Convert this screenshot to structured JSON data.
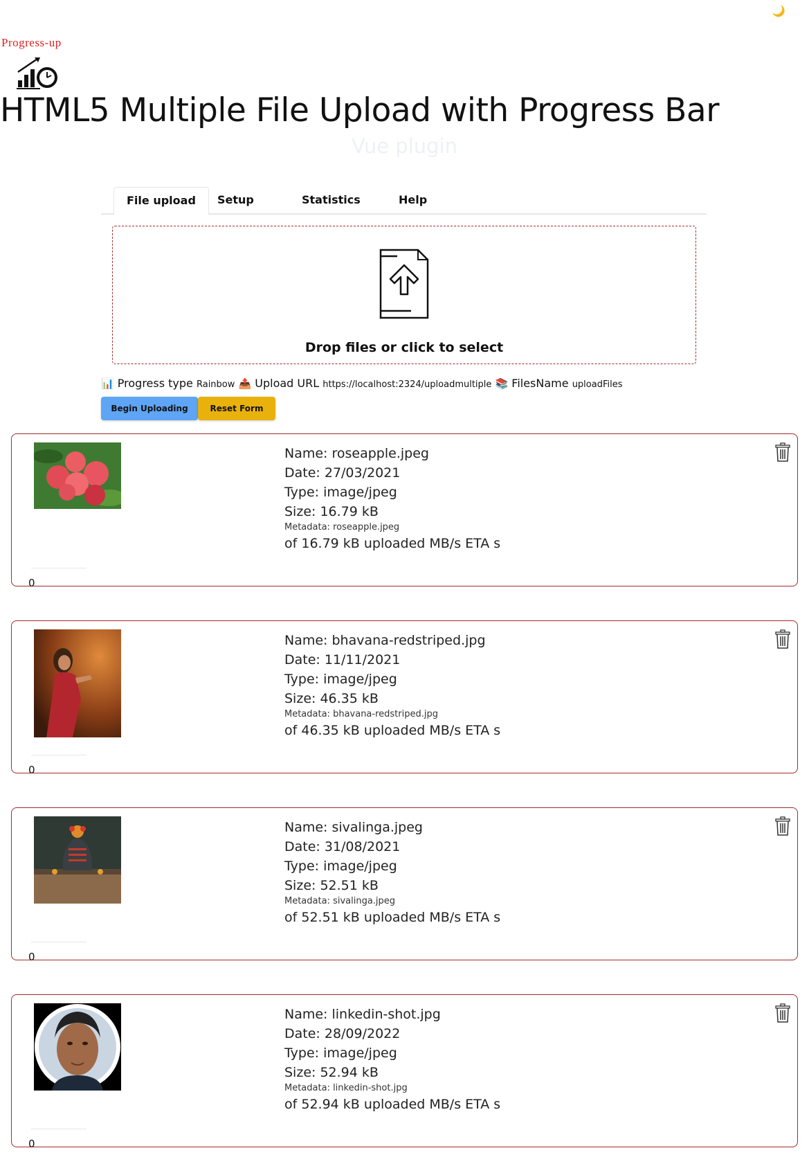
{
  "header": {
    "brand": "Progress-up",
    "title": "HTML5 Multiple File Upload with Progress Bar",
    "subtitle": "Vue plugin",
    "theme_toggle_icon": "moon-icon"
  },
  "tabs": [
    {
      "label": "File upload",
      "active": true
    },
    {
      "label": "Setup",
      "active": false
    },
    {
      "label": "Statistics",
      "active": false
    },
    {
      "label": "Help",
      "active": false
    }
  ],
  "dropzone": {
    "icon": "file-upload-icon",
    "label": "Drop files or click to select"
  },
  "config": {
    "progress_type_icon": "📊",
    "progress_type_label": "Progress type",
    "progress_type_value": "Rainbow",
    "upload_url_icon": "📤",
    "upload_url_label": "Upload URL",
    "upload_url_value": "https://localhost:2324/uploadmultiple",
    "files_name_icon": "📚",
    "files_name_label": "FilesName",
    "files_name_value": "uploadFiles"
  },
  "actions": {
    "begin_label": "Begin Uploading",
    "reset_label": "Reset Form"
  },
  "colors": {
    "accent_border": "#a52a2a",
    "begin_button": "#5ea5f5",
    "reset_button": "#e8b10c",
    "brand": "#e02020"
  },
  "files": [
    {
      "name": "Name: roseapple.jpeg",
      "date": "Date: 27/03/2021",
      "type": "Type: image/jpeg",
      "size": "Size: 16.79 kB",
      "metadata": "Metadata: roseapple.jpeg",
      "status": "of 16.79 kB uploaded MB/s ETA s",
      "progress": "0",
      "thumbnail": "rose-apple-photo"
    },
    {
      "name": "Name: bhavana-redstriped.jpg",
      "date": "Date: 11/11/2021",
      "type": "Type: image/jpeg",
      "size": "Size: 46.35 kB",
      "metadata": "Metadata: bhavana-redstriped.jpg",
      "status": "of 46.35 kB uploaded MB/s ETA s",
      "progress": "0",
      "thumbnail": "woman-red-dress-photo"
    },
    {
      "name": "Name: sivalinga.jpeg",
      "date": "Date: 31/08/2021",
      "type": "Type: image/jpeg",
      "size": "Size: 52.51 kB",
      "metadata": "Metadata: sivalinga.jpeg",
      "status": "of 52.51 kB uploaded MB/s ETA s",
      "progress": "0",
      "thumbnail": "sivalinga-photo"
    },
    {
      "name": "Name: linkedin-shot.jpg",
      "date": "Date: 28/09/2022",
      "type": "Type: image/jpeg",
      "size": "Size: 52.94 kB",
      "metadata": "Metadata: linkedin-shot.jpg",
      "status": "of 52.94 kB uploaded MB/s ETA s",
      "progress": "0",
      "thumbnail": "portrait-photo"
    }
  ]
}
